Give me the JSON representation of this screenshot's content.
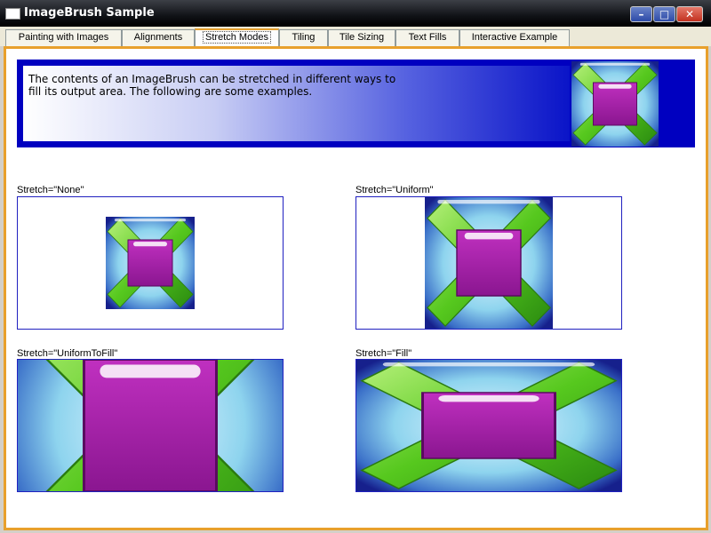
{
  "window": {
    "title": "ImageBrush Sample",
    "controls": {
      "minimize": "–",
      "maximize": "□",
      "close": "✕"
    }
  },
  "tabs": [
    {
      "label": "Painting with Images"
    },
    {
      "label": "Alignments"
    },
    {
      "label": "Stretch Modes",
      "active": true
    },
    {
      "label": "Tiling"
    },
    {
      "label": "Tile Sizing"
    },
    {
      "label": "Text Fills"
    },
    {
      "label": "Interactive Example"
    }
  ],
  "banner": {
    "text": "The contents of an ImageBrush can be stretched in different ways to fill its output area. The following are some examples."
  },
  "examples": [
    {
      "caption": "Stretch=\"None\""
    },
    {
      "caption": "Stretch=\"Uniform\""
    },
    {
      "caption": "Stretch=\"UniformToFill\""
    },
    {
      "caption": "Stretch=\"Fill\""
    }
  ],
  "colors": {
    "accent_border": "#e8a02c",
    "banner_blue": "#0000c0",
    "box_border": "#2020c0",
    "square_purple": "#a020a0",
    "x_green": "#4cc020"
  }
}
